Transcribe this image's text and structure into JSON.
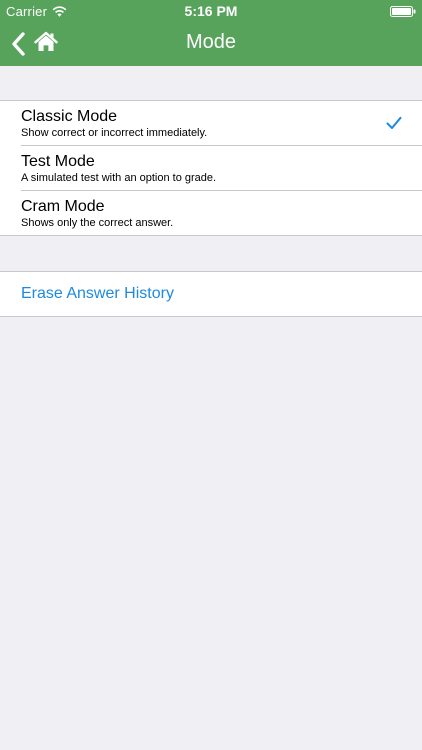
{
  "status_bar": {
    "carrier": "Carrier",
    "time": "5:16 PM",
    "wifi_icon": "wifi-icon",
    "battery_icon": "battery-icon"
  },
  "nav_bar": {
    "title": "Mode",
    "back_icon": "chevron-left-icon",
    "home_icon": "home-icon",
    "background_color": "#57a35c"
  },
  "modes": [
    {
      "title": "Classic Mode",
      "subtitle": "Show correct or incorrect immediately.",
      "selected": true
    },
    {
      "title": "Test Mode",
      "subtitle": "A simulated test with an option to grade.",
      "selected": false
    },
    {
      "title": "Cram Mode",
      "subtitle": "Shows only the correct answer.",
      "selected": false
    }
  ],
  "selection_icon": "checkmark-icon",
  "actions": {
    "erase_history": "Erase Answer History"
  },
  "colors": {
    "accent": "#1d8ae0",
    "background": "#efeff4",
    "separator": "#c8c7cc"
  }
}
